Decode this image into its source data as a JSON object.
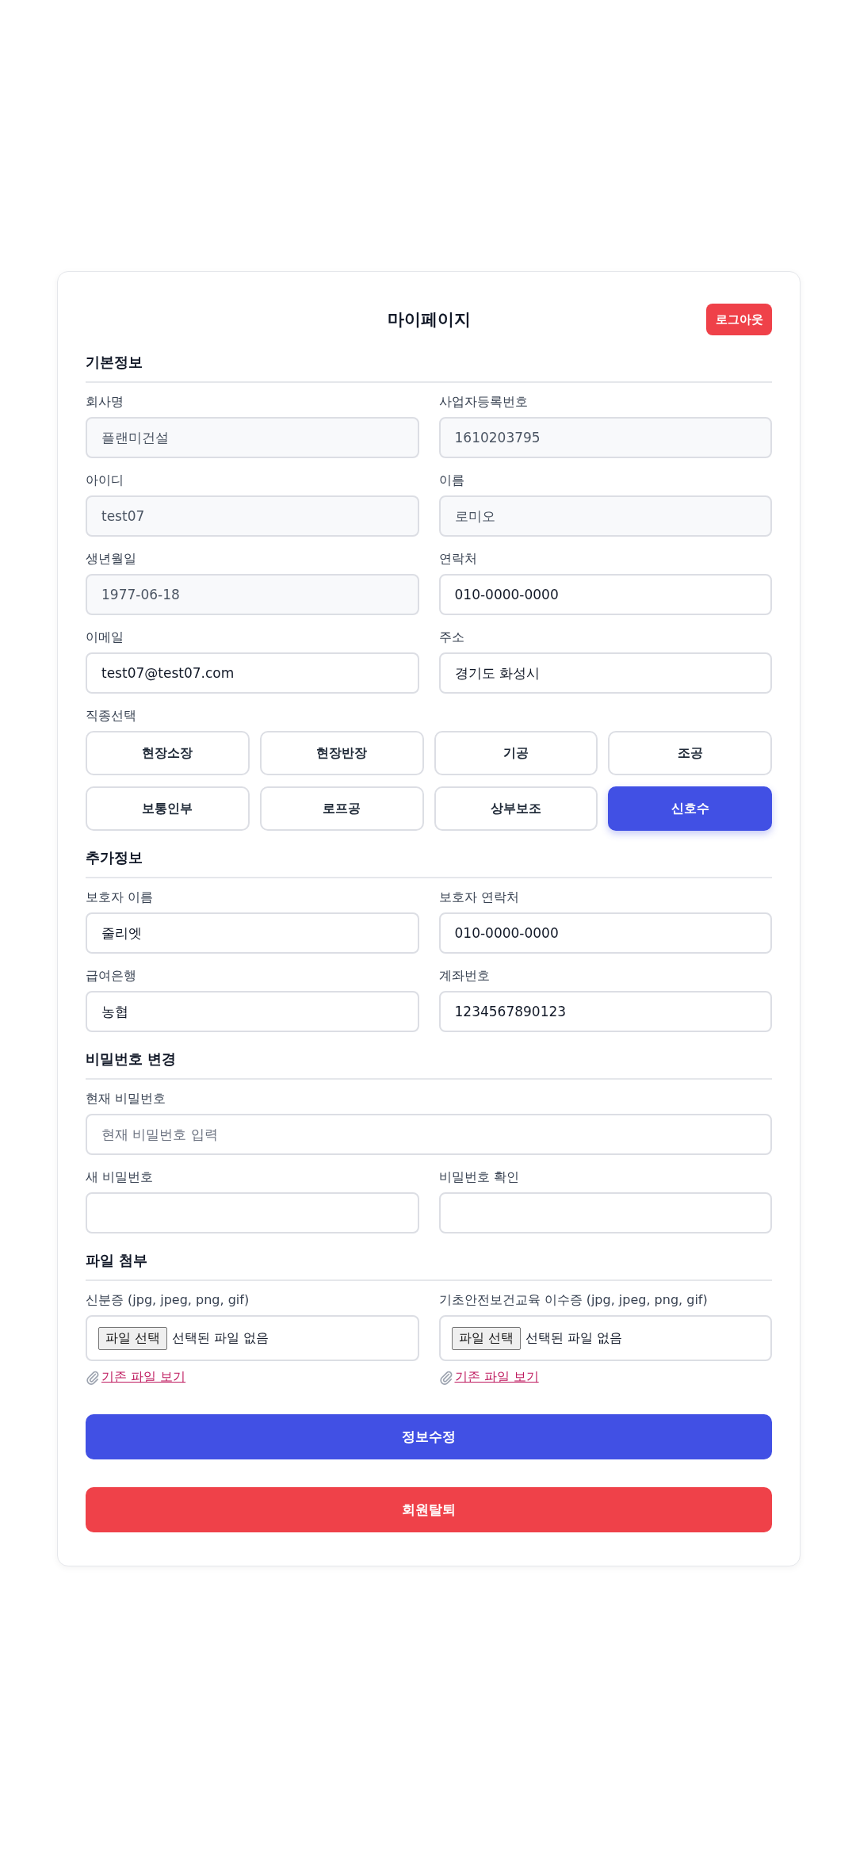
{
  "title": "마이페이지",
  "logout_button": "로그아웃",
  "basic_info": {
    "heading": "기본정보",
    "fields": [
      {
        "label": "회사명",
        "value": "플랜미건설",
        "disabled": true
      },
      {
        "label": "사업자등록번호",
        "value": "1610203795",
        "disabled": true
      },
      {
        "label": "아이디",
        "value": "test07",
        "disabled": true
      },
      {
        "label": "이름",
        "value": "로미오",
        "disabled": true
      },
      {
        "label": "생년월일",
        "value": "1977-06-18",
        "disabled": true
      },
      {
        "label": "연락처",
        "value": "010-0000-0000",
        "disabled": false
      },
      {
        "label": "이메일",
        "value": "test07@test07.com",
        "disabled": false
      },
      {
        "label": "주소",
        "value": "경기도 화성시",
        "disabled": false
      }
    ]
  },
  "job_select": {
    "label": "직종선택",
    "options": [
      {
        "label": "현장소장",
        "selected": false
      },
      {
        "label": "현장반장",
        "selected": false
      },
      {
        "label": "기공",
        "selected": false
      },
      {
        "label": "조공",
        "selected": false
      },
      {
        "label": "보통인부",
        "selected": false
      },
      {
        "label": "로프공",
        "selected": false
      },
      {
        "label": "상부보조",
        "selected": false
      },
      {
        "label": "신호수",
        "selected": true
      }
    ]
  },
  "extra_info": {
    "heading": "추가정보",
    "fields": [
      {
        "label": "보호자 이름",
        "value": "줄리엣",
        "disabled": false
      },
      {
        "label": "보호자 연락처",
        "value": "010-0000-0000",
        "disabled": false
      },
      {
        "label": "급여은행",
        "value": "농협",
        "disabled": false
      },
      {
        "label": "계좌번호",
        "value": "1234567890123",
        "disabled": false
      }
    ]
  },
  "password": {
    "heading": "비밀번호 변경",
    "current": {
      "label": "현재 비밀번호",
      "placeholder": "현재 비밀번호 입력"
    },
    "new_fields": [
      {
        "label": "새 비밀번호"
      },
      {
        "label": "비밀번호 확인"
      }
    ]
  },
  "files": {
    "heading": "파일 첨부",
    "items": [
      {
        "label": "신분증 (jpg, jpeg, png, gif)",
        "button": "파일 선택",
        "status": "선택된 파일 없음",
        "link": "기존 파일 보기"
      },
      {
        "label": "기초안전보건교육 이수증 (jpg, jpeg, png, gif)",
        "button": "파일 선택",
        "status": "선택된 파일 없음",
        "link": "기존 파일 보기"
      }
    ]
  },
  "submit_button": "정보수정",
  "withdraw_button": "회원탈퇴"
}
